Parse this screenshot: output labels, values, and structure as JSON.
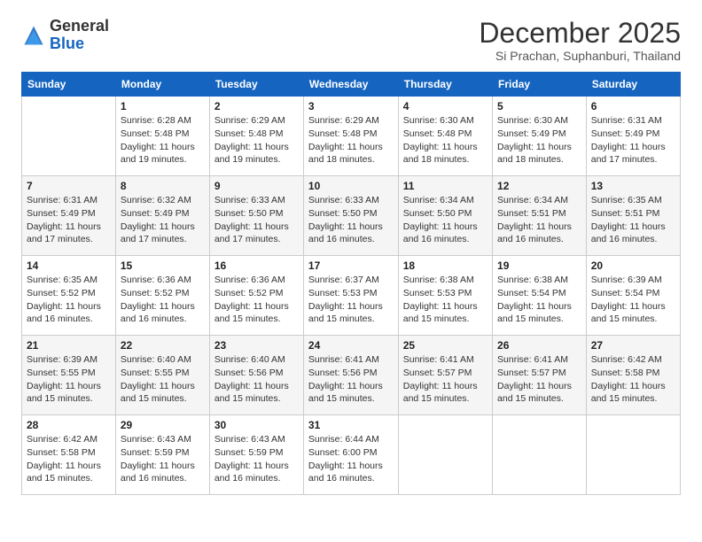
{
  "logo": {
    "general": "General",
    "blue": "Blue"
  },
  "header": {
    "month": "December 2025",
    "location": "Si Prachan, Suphanburi, Thailand"
  },
  "weekdays": [
    "Sunday",
    "Monday",
    "Tuesday",
    "Wednesday",
    "Thursday",
    "Friday",
    "Saturday"
  ],
  "weeks": [
    [
      {
        "day": "",
        "sunrise": "",
        "sunset": "",
        "daylight": ""
      },
      {
        "day": "1",
        "sunrise": "Sunrise: 6:28 AM",
        "sunset": "Sunset: 5:48 PM",
        "daylight": "Daylight: 11 hours and 19 minutes."
      },
      {
        "day": "2",
        "sunrise": "Sunrise: 6:29 AM",
        "sunset": "Sunset: 5:48 PM",
        "daylight": "Daylight: 11 hours and 19 minutes."
      },
      {
        "day": "3",
        "sunrise": "Sunrise: 6:29 AM",
        "sunset": "Sunset: 5:48 PM",
        "daylight": "Daylight: 11 hours and 18 minutes."
      },
      {
        "day": "4",
        "sunrise": "Sunrise: 6:30 AM",
        "sunset": "Sunset: 5:48 PM",
        "daylight": "Daylight: 11 hours and 18 minutes."
      },
      {
        "day": "5",
        "sunrise": "Sunrise: 6:30 AM",
        "sunset": "Sunset: 5:49 PM",
        "daylight": "Daylight: 11 hours and 18 minutes."
      },
      {
        "day": "6",
        "sunrise": "Sunrise: 6:31 AM",
        "sunset": "Sunset: 5:49 PM",
        "daylight": "Daylight: 11 hours and 17 minutes."
      }
    ],
    [
      {
        "day": "7",
        "sunrise": "Sunrise: 6:31 AM",
        "sunset": "Sunset: 5:49 PM",
        "daylight": "Daylight: 11 hours and 17 minutes."
      },
      {
        "day": "8",
        "sunrise": "Sunrise: 6:32 AM",
        "sunset": "Sunset: 5:49 PM",
        "daylight": "Daylight: 11 hours and 17 minutes."
      },
      {
        "day": "9",
        "sunrise": "Sunrise: 6:33 AM",
        "sunset": "Sunset: 5:50 PM",
        "daylight": "Daylight: 11 hours and 17 minutes."
      },
      {
        "day": "10",
        "sunrise": "Sunrise: 6:33 AM",
        "sunset": "Sunset: 5:50 PM",
        "daylight": "Daylight: 11 hours and 16 minutes."
      },
      {
        "day": "11",
        "sunrise": "Sunrise: 6:34 AM",
        "sunset": "Sunset: 5:50 PM",
        "daylight": "Daylight: 11 hours and 16 minutes."
      },
      {
        "day": "12",
        "sunrise": "Sunrise: 6:34 AM",
        "sunset": "Sunset: 5:51 PM",
        "daylight": "Daylight: 11 hours and 16 minutes."
      },
      {
        "day": "13",
        "sunrise": "Sunrise: 6:35 AM",
        "sunset": "Sunset: 5:51 PM",
        "daylight": "Daylight: 11 hours and 16 minutes."
      }
    ],
    [
      {
        "day": "14",
        "sunrise": "Sunrise: 6:35 AM",
        "sunset": "Sunset: 5:52 PM",
        "daylight": "Daylight: 11 hours and 16 minutes."
      },
      {
        "day": "15",
        "sunrise": "Sunrise: 6:36 AM",
        "sunset": "Sunset: 5:52 PM",
        "daylight": "Daylight: 11 hours and 16 minutes."
      },
      {
        "day": "16",
        "sunrise": "Sunrise: 6:36 AM",
        "sunset": "Sunset: 5:52 PM",
        "daylight": "Daylight: 11 hours and 15 minutes."
      },
      {
        "day": "17",
        "sunrise": "Sunrise: 6:37 AM",
        "sunset": "Sunset: 5:53 PM",
        "daylight": "Daylight: 11 hours and 15 minutes."
      },
      {
        "day": "18",
        "sunrise": "Sunrise: 6:38 AM",
        "sunset": "Sunset: 5:53 PM",
        "daylight": "Daylight: 11 hours and 15 minutes."
      },
      {
        "day": "19",
        "sunrise": "Sunrise: 6:38 AM",
        "sunset": "Sunset: 5:54 PM",
        "daylight": "Daylight: 11 hours and 15 minutes."
      },
      {
        "day": "20",
        "sunrise": "Sunrise: 6:39 AM",
        "sunset": "Sunset: 5:54 PM",
        "daylight": "Daylight: 11 hours and 15 minutes."
      }
    ],
    [
      {
        "day": "21",
        "sunrise": "Sunrise: 6:39 AM",
        "sunset": "Sunset: 5:55 PM",
        "daylight": "Daylight: 11 hours and 15 minutes."
      },
      {
        "day": "22",
        "sunrise": "Sunrise: 6:40 AM",
        "sunset": "Sunset: 5:55 PM",
        "daylight": "Daylight: 11 hours and 15 minutes."
      },
      {
        "day": "23",
        "sunrise": "Sunrise: 6:40 AM",
        "sunset": "Sunset: 5:56 PM",
        "daylight": "Daylight: 11 hours and 15 minutes."
      },
      {
        "day": "24",
        "sunrise": "Sunrise: 6:41 AM",
        "sunset": "Sunset: 5:56 PM",
        "daylight": "Daylight: 11 hours and 15 minutes."
      },
      {
        "day": "25",
        "sunrise": "Sunrise: 6:41 AM",
        "sunset": "Sunset: 5:57 PM",
        "daylight": "Daylight: 11 hours and 15 minutes."
      },
      {
        "day": "26",
        "sunrise": "Sunrise: 6:41 AM",
        "sunset": "Sunset: 5:57 PM",
        "daylight": "Daylight: 11 hours and 15 minutes."
      },
      {
        "day": "27",
        "sunrise": "Sunrise: 6:42 AM",
        "sunset": "Sunset: 5:58 PM",
        "daylight": "Daylight: 11 hours and 15 minutes."
      }
    ],
    [
      {
        "day": "28",
        "sunrise": "Sunrise: 6:42 AM",
        "sunset": "Sunset: 5:58 PM",
        "daylight": "Daylight: 11 hours and 15 minutes."
      },
      {
        "day": "29",
        "sunrise": "Sunrise: 6:43 AM",
        "sunset": "Sunset: 5:59 PM",
        "daylight": "Daylight: 11 hours and 16 minutes."
      },
      {
        "day": "30",
        "sunrise": "Sunrise: 6:43 AM",
        "sunset": "Sunset: 5:59 PM",
        "daylight": "Daylight: 11 hours and 16 minutes."
      },
      {
        "day": "31",
        "sunrise": "Sunrise: 6:44 AM",
        "sunset": "Sunset: 6:00 PM",
        "daylight": "Daylight: 11 hours and 16 minutes."
      },
      {
        "day": "",
        "sunrise": "",
        "sunset": "",
        "daylight": ""
      },
      {
        "day": "",
        "sunrise": "",
        "sunset": "",
        "daylight": ""
      },
      {
        "day": "",
        "sunrise": "",
        "sunset": "",
        "daylight": ""
      }
    ]
  ]
}
